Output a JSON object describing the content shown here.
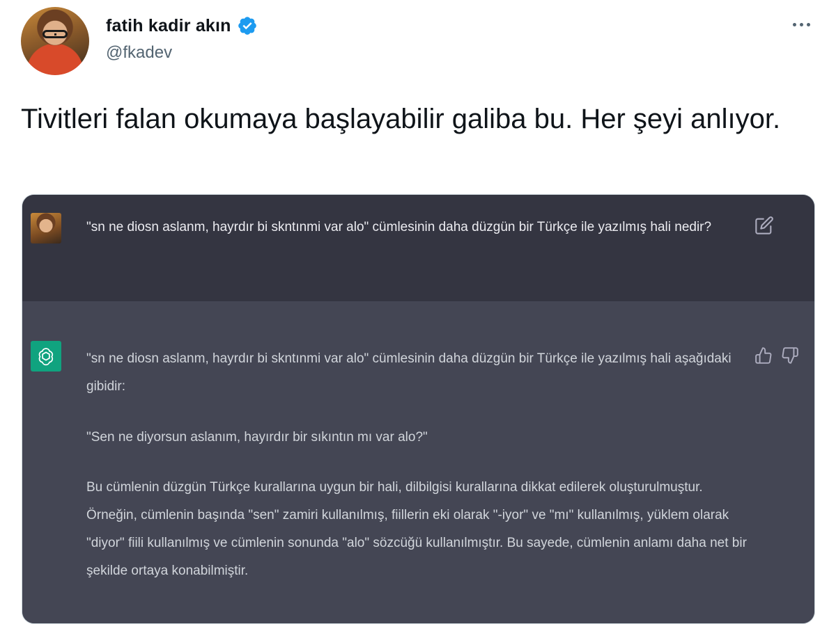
{
  "author": {
    "display_name": "fatih kadir akın",
    "handle": "@fkadev"
  },
  "tweet": {
    "text": "Tivitleri falan okumaya başlayabilir galiba bu. Her şeyi anlıyor."
  },
  "chat": {
    "user_message": "\"sn ne diosn aslanm, hayrdır bi skntınmi var alo\" cümlesinin daha düzgün bir Türkçe ile yazılmış hali nedir?",
    "assistant_paragraphs": [
      "\"sn ne diosn aslanm, hayrdır bi skntınmi var alo\" cümlesinin daha düzgün bir Türkçe ile yazılmış hali aşağıdaki gibidir:",
      "\"Sen ne diyorsun aslanım, hayırdır bir sıkıntın mı var alo?\"",
      "Bu cümlenin düzgün Türkçe kurallarına uygun bir hali, dilbilgisi kurallarına dikkat edilerek oluşturulmuştur. Örneğin, cümlenin başında \"sen\" zamiri kullanılmış, fiillerin eki olarak \"-iyor\" ve \"mı\" kullanılmış, yüklem olarak \"diyor\" fiili kullanılmış ve cümlenin sonunda \"alo\" sözcüğü kullanılmıştır. Bu sayede, cümlenin anlamı daha net bir şekilde ortaya konabilmiştir."
    ]
  },
  "colors": {
    "verified_badge": "#1d9bf0",
    "user_row_bg": "#343541",
    "assistant_row_bg": "#444654",
    "assistant_avatar_bg": "#10a37f"
  },
  "icons": {
    "verified": "verified-badge-icon",
    "more": "more-horizontal-icon",
    "edit": "edit-icon",
    "assistant_logo": "openai-logo-icon",
    "thumbs_up": "thumbs-up-icon",
    "thumbs_down": "thumbs-down-icon"
  }
}
